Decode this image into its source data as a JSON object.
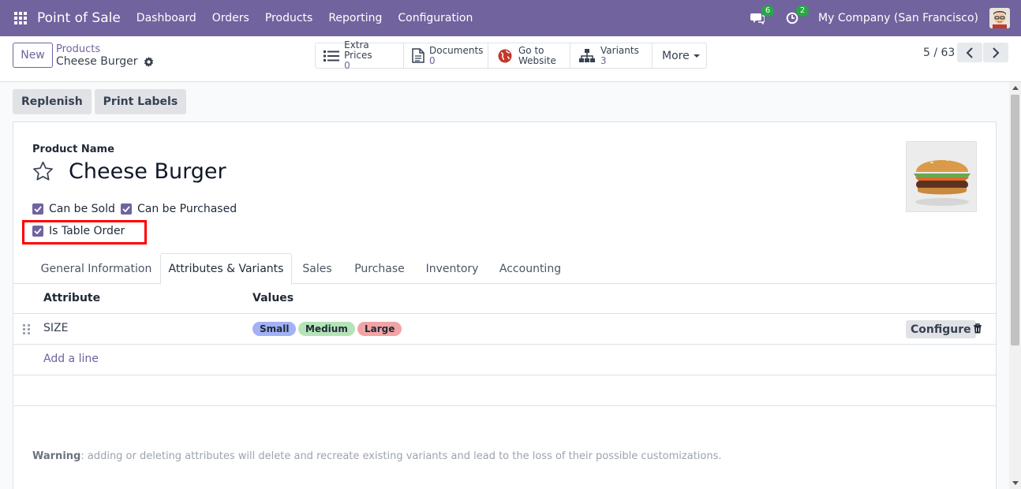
{
  "navbar": {
    "app_name": "Point of Sale",
    "menu": [
      "Dashboard",
      "Orders",
      "Products",
      "Reporting",
      "Configuration"
    ],
    "messages_count": "6",
    "activities_count": "2",
    "company": "My Company (San Francisco)"
  },
  "control": {
    "new_label": "New",
    "breadcrumb_parent": "Products",
    "breadcrumb_current": "Cheese Burger",
    "smart_buttons": [
      {
        "label": "Extra Prices",
        "value": "0",
        "icon": "list-icon"
      },
      {
        "label": "Documents",
        "value": "0",
        "icon": "document-icon"
      },
      {
        "label": "Go to",
        "value": "Website",
        "icon": "globe-icon"
      },
      {
        "label": "Variants",
        "value": "3",
        "icon": "sitemap-icon"
      }
    ],
    "more_label": "More",
    "pager": "5 / 63"
  },
  "actions": {
    "replenish": "Replenish",
    "print_labels": "Print Labels"
  },
  "form": {
    "product_name_label": "Product Name",
    "product_name": "Cheese Burger",
    "can_be_sold": "Can be Sold",
    "can_be_purchased": "Can be Purchased",
    "is_table_order": "Is Table Order"
  },
  "tabs": [
    "General Information",
    "Attributes & Variants",
    "Sales",
    "Purchase",
    "Inventory",
    "Accounting"
  ],
  "active_tab": "Attributes & Variants",
  "table": {
    "headers": {
      "attribute": "Attribute",
      "values": "Values"
    },
    "rows": [
      {
        "attribute": "SIZE",
        "values": [
          "Small",
          "Medium",
          "Large"
        ],
        "configure": "Configure"
      }
    ],
    "add_line": "Add a line"
  },
  "warning": {
    "label": "Warning",
    "text": ": adding or deleting attributes will delete and recreate existing variants and lead to the loss of their possible customizations."
  },
  "colors": {
    "brand": "#71639e",
    "tag_small": "#a3b1f6",
    "tag_medium": "#b5e3b8",
    "tag_large": "#f2a4a4",
    "highlight": "#ff0000"
  }
}
